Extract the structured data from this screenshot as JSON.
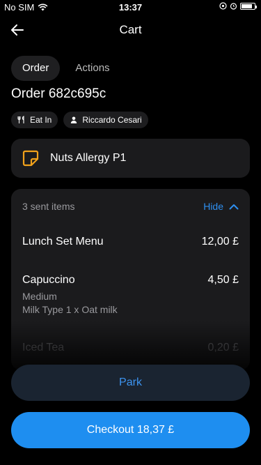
{
  "status_bar": {
    "carrier": "No SIM",
    "time": "13:37"
  },
  "header": {
    "title": "Cart"
  },
  "tabs": [
    {
      "label": "Order",
      "active": true
    },
    {
      "label": "Actions",
      "active": false
    }
  ],
  "order": {
    "title": "Order 682c695c",
    "chips": [
      {
        "label": "Eat In",
        "icon": "fork-knife-icon"
      },
      {
        "label": "Riccardo Cesari",
        "icon": "person-icon"
      }
    ]
  },
  "note": {
    "text": "Nuts Allergy P1",
    "icon": "note-icon",
    "accent": "#f2a21b"
  },
  "items_section": {
    "count_label": "3 sent items",
    "toggle_label": "Hide",
    "items": [
      {
        "name": "Lunch Set Menu",
        "price": "12,00 £"
      },
      {
        "name": "Capuccino",
        "price": "4,50 £",
        "sub1": "Medium",
        "sub2": "Milk Type 1 x Oat milk"
      },
      {
        "name": "Iced Tea",
        "price": "0,20 £"
      }
    ]
  },
  "buttons": {
    "park": "Park",
    "checkout": "Checkout 18,37 £"
  },
  "colors": {
    "accent": "#1e8ef0",
    "background": "#000000",
    "card": "#1b1b1d"
  }
}
